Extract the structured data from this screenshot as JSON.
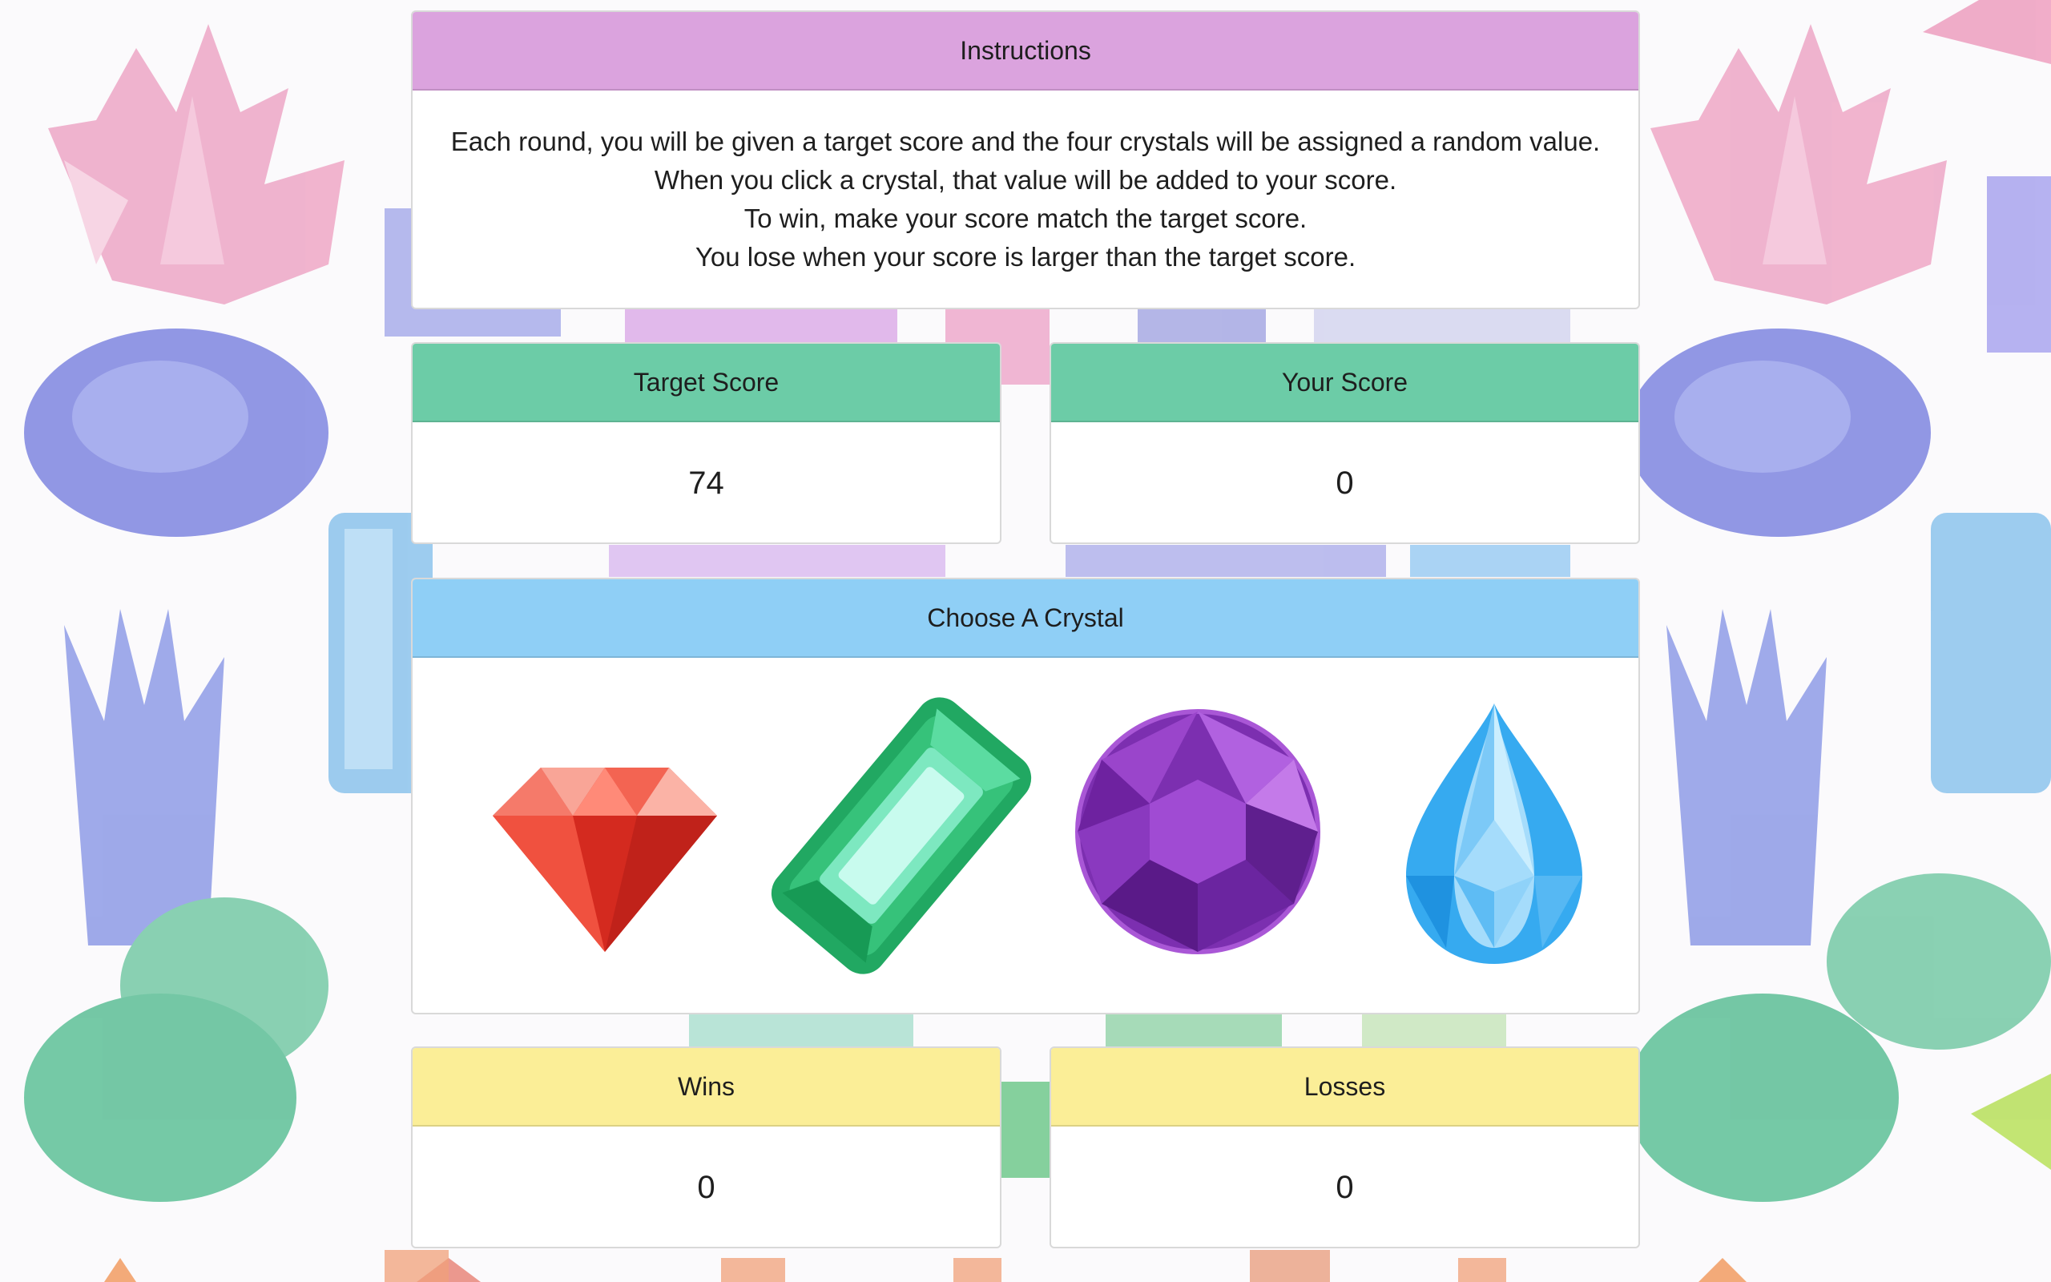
{
  "instructions": {
    "title": "Instructions",
    "lines": [
      "Each round, you will be given a target score and the four crystals will be assigned a random value.",
      "When you click a crystal, that value will be added to your score.",
      "To win, make your score match the target score.",
      "You lose when your score is larger than the target score."
    ]
  },
  "target": {
    "title": "Target Score",
    "value": "74"
  },
  "score": {
    "title": "Your Score",
    "value": "0"
  },
  "crystals": {
    "title": "Choose A Crystal",
    "items": [
      {
        "name": "red-diamond",
        "color": "#e8372b"
      },
      {
        "name": "green-emerald",
        "color": "#2bbd6e"
      },
      {
        "name": "purple-amethyst",
        "color": "#7c2fb0"
      },
      {
        "name": "blue-teardrop",
        "color": "#36aaf0"
      }
    ]
  },
  "wins": {
    "title": "Wins",
    "value": "0"
  },
  "losses": {
    "title": "Losses",
    "value": "0"
  }
}
